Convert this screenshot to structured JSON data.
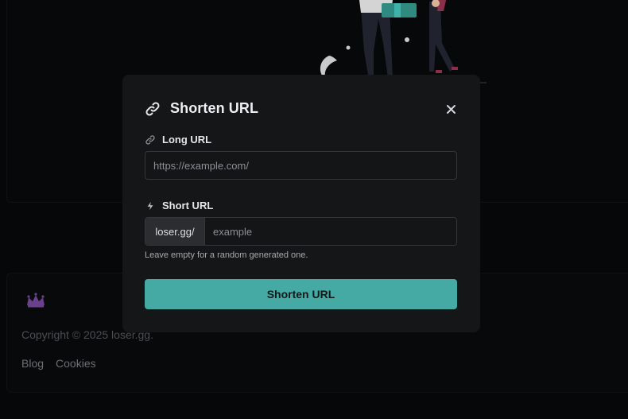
{
  "modal": {
    "title": "Shorten URL",
    "title_icon": "link-icon",
    "close_icon": "close-icon",
    "long_url": {
      "label": "Long URL",
      "icon": "link-icon",
      "placeholder": "https://example.com/",
      "value": ""
    },
    "short_url": {
      "label": "Short URL",
      "icon": "lightning-icon",
      "prefix": "loser.gg/",
      "placeholder": "example",
      "value": "",
      "help": "Leave empty for a random generated one."
    },
    "submit_label": "Shorten URL"
  },
  "footer": {
    "logo_icon": "crown-icon",
    "copyright": "Copyright © 2025 loser.gg.",
    "links": [
      {
        "label": "Blog"
      },
      {
        "label": "Cookies"
      }
    ]
  },
  "colors": {
    "accent": "#45aaa4",
    "modal_bg": "#151618",
    "page_bg": "#060708",
    "crown": "#6a3f8c"
  }
}
